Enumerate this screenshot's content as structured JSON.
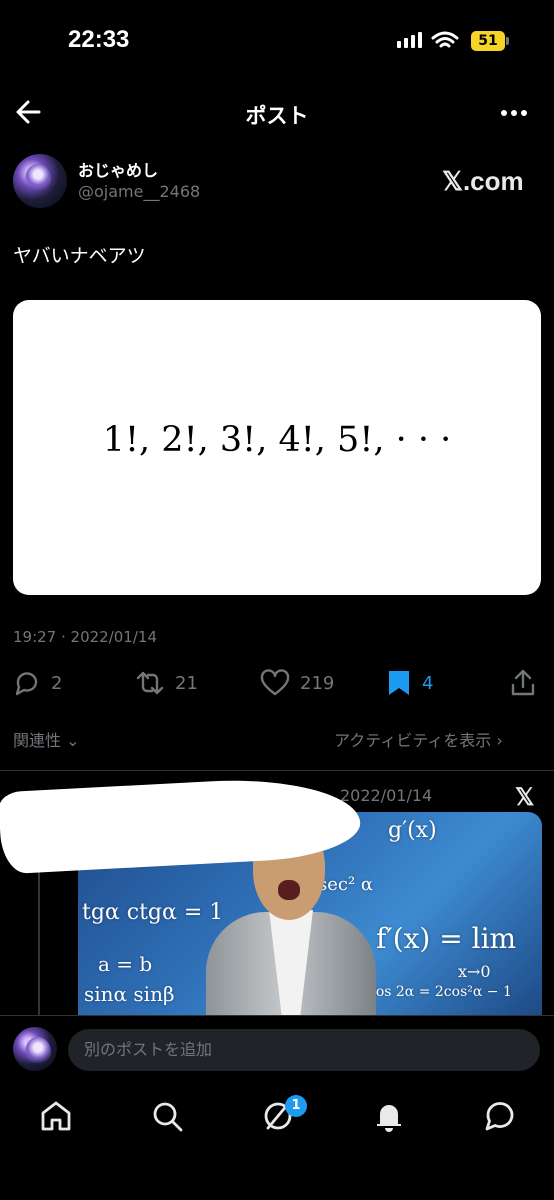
{
  "status": {
    "time": "22:33",
    "battery": "51"
  },
  "header": {
    "title": "ポスト"
  },
  "author": {
    "name": "おじゃめし",
    "handle": "@ojame__2468",
    "source_label": "𝕏.com"
  },
  "post": {
    "text": "ヤバいナベアツ",
    "media_text": "1!,  2!,  3!,  4!,  5!,  · · ·",
    "timestamp": "19:27 · 2022/01/14"
  },
  "actions": {
    "replies": "2",
    "reposts": "21",
    "likes": "219",
    "bookmarks": "4"
  },
  "sort": {
    "relevance_label": "関連性",
    "activity_label": "アクティビティを表示"
  },
  "quoted": {
    "date": "2022/01/14",
    "source_label": "𝕏"
  },
  "composer": {
    "placeholder": "別のポストを追加"
  },
  "tabbar": {
    "notification_badge": "1"
  },
  "colors": {
    "accent": "#1d9bf0",
    "muted": "#71767b",
    "background": "#000000"
  }
}
